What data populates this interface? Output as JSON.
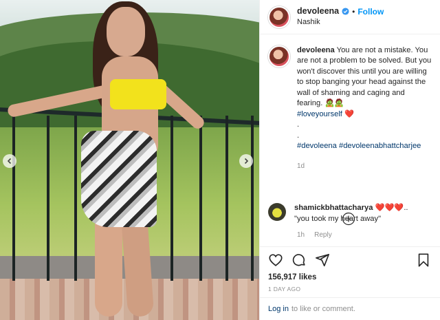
{
  "post": {
    "username": "devoleena",
    "follow_label": "Follow",
    "separator": "•",
    "location": "Nashik"
  },
  "caption": {
    "username": "devoleena",
    "text": "You are not a mistake. You are not a problem to be solved. But you won't discover this until you are willing to stop banging your head against the wall of shaming and caging and fearing.",
    "emoji": "🧟🧟",
    "hashtag_1": "#loveyourself",
    "heart": "❤️",
    "dot_1": ".",
    "dot_2": ".",
    "hashtag_2": "#devoleena",
    "hashtag_3": "#devoleenabhattcharjee",
    "time": "1d"
  },
  "comment": {
    "username": "shamickbhattacharya",
    "hearts": "❤️❤️❤️..",
    "text": "\"you took my heart away\"",
    "time": "1h",
    "reply_label": "Reply"
  },
  "stats": {
    "likes": "156,917 likes",
    "date": "1 DAY AGO"
  },
  "login": {
    "link_text": "Log in",
    "rest_text": "to like or comment."
  },
  "colors": {
    "link_blue": "#0095f6",
    "hashtag": "#00376b",
    "muted": "#8e8e8e"
  },
  "icons": [
    "verified-badge-icon",
    "chevron-left-icon",
    "chevron-right-icon",
    "heart-icon",
    "comment-icon",
    "share-icon",
    "bookmark-icon",
    "plus-circle-icon"
  ]
}
